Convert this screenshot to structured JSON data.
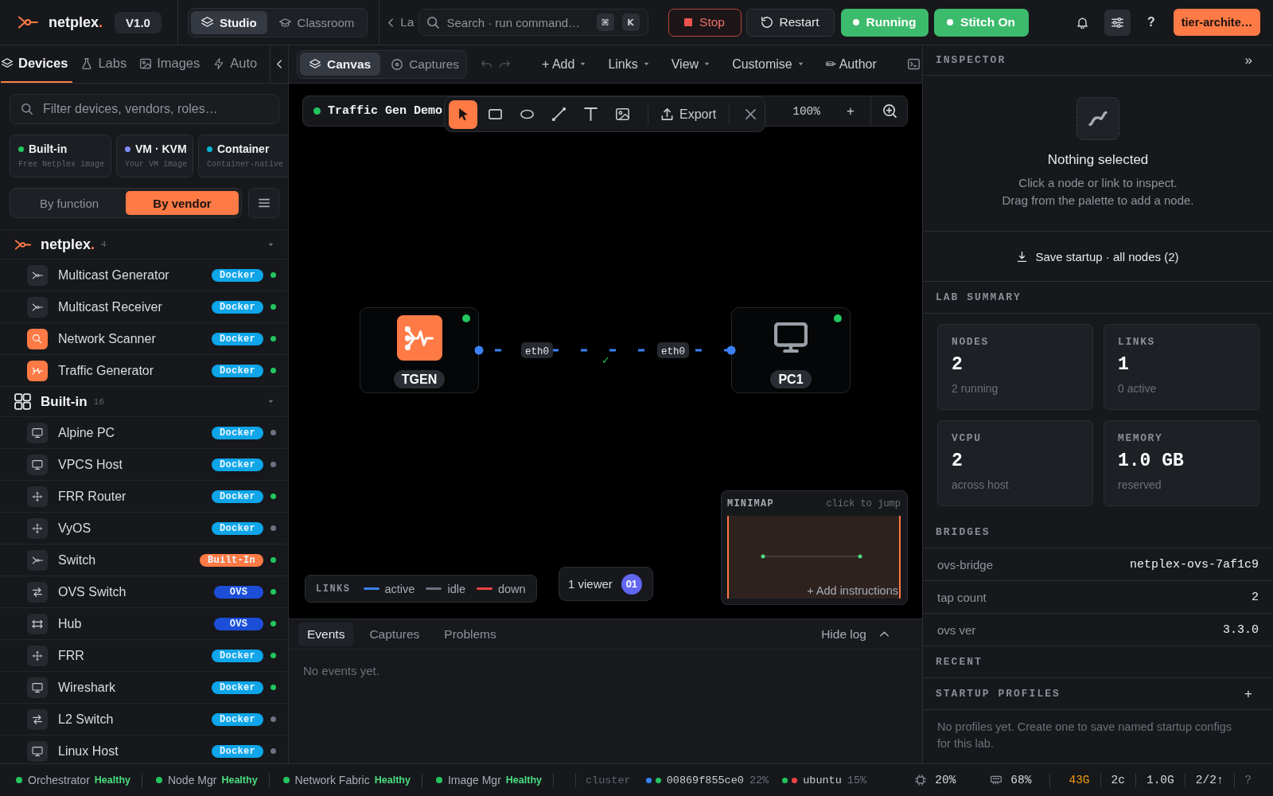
{
  "top_bar": {
    "brand": {
      "name": "netplex",
      "accent": "."
    },
    "version": "V1.0",
    "modes": [
      {
        "label": "Studio",
        "selected": true
      },
      {
        "label": "Classroom",
        "selected": false
      }
    ],
    "back_link": "La",
    "search": {
      "placeholder": "Search · run command…",
      "keys": [
        "⌘",
        "K"
      ]
    },
    "actions": [
      {
        "kind": "stop",
        "label": "Stop"
      },
      {
        "kind": "restart",
        "label": "Restart"
      },
      {
        "kind": "running",
        "label": "Running"
      },
      {
        "kind": "toggle",
        "label": "Stitch On"
      }
    ],
    "help": "?",
    "user": "tier-archite…"
  },
  "sidebar": {
    "tabs": [
      {
        "label": "Devices",
        "selected": true
      },
      {
        "label": "Labs",
        "selected": false
      },
      {
        "label": "Images",
        "selected": false
      },
      {
        "label": "Auto",
        "selected": false
      }
    ],
    "filter": {
      "placeholder": "Filter devices, vendors, roles…"
    },
    "sources": [
      {
        "title": "Built-in",
        "subtitle": "Free Netplex image",
        "color": "#22c55e"
      },
      {
        "title": "VM · KVM",
        "subtitle": "Your VM image",
        "color": "#818cf8"
      },
      {
        "title": "Container",
        "subtitle": "Container-native",
        "color": "#06b6d4"
      }
    ],
    "grouping": [
      {
        "label": "By function",
        "selected": false
      },
      {
        "label": "By vendor",
        "selected": true
      }
    ],
    "groups": [
      {
        "kind": "brand",
        "name": "netplex",
        "accent": ".",
        "count": "4",
        "expanded": true,
        "items": [
          {
            "kind": "multicast",
            "name": "Multicast Generator",
            "badge": {
              "label": "Docker",
              "color": "#0ea5e9"
            },
            "dot": {
              "color": "#22c55e"
            }
          },
          {
            "kind": "multicast",
            "name": "Multicast Receiver",
            "badge": {
              "label": "Docker",
              "color": "#0ea5e9"
            },
            "dot": {
              "color": "#22c55e"
            }
          },
          {
            "kind": "scanner",
            "name": "Network Scanner",
            "badge": {
              "label": "Docker",
              "color": "#0ea5e9"
            },
            "dot": {
              "color": "#22c55e"
            }
          },
          {
            "kind": "traffic",
            "name": "Traffic Generator",
            "badge": {
              "label": "Docker",
              "color": "#0ea5e9"
            },
            "dot": {
              "color": "#22c55e"
            }
          }
        ]
      },
      {
        "kind": "builtin",
        "name": "Built-in",
        "count": "16",
        "expanded": true,
        "items": [
          {
            "kind": "host",
            "name": "Alpine PC",
            "badge": {
              "label": "Docker",
              "color": "#0ea5e9"
            },
            "dot": {
              "color": "#6b7280"
            }
          },
          {
            "kind": "host",
            "name": "VPCS Host",
            "badge": {
              "label": "Docker",
              "color": "#0ea5e9"
            },
            "dot": {
              "color": "#6b7280"
            }
          },
          {
            "kind": "router",
            "name": "FRR Router",
            "badge": {
              "label": "Docker",
              "color": "#0ea5e9"
            },
            "dot": {
              "color": "#22c55e"
            }
          },
          {
            "kind": "router",
            "name": "VyOS",
            "badge": {
              "label": "Docker",
              "color": "#0ea5e9"
            },
            "dot": {
              "color": "#6b7280"
            }
          },
          {
            "kind": "multicast",
            "name": "Switch",
            "badge": {
              "label": "Built-In",
              "color": "#ff7a45"
            },
            "dot": {
              "color": "#22c55e"
            }
          },
          {
            "kind": "switch",
            "name": "OVS Switch",
            "badge": {
              "label": "OVS",
              "color": "#1d4ed8"
            },
            "dot": {
              "color": "#22c55e"
            }
          },
          {
            "kind": "hub",
            "name": "Hub",
            "badge": {
              "label": "OVS",
              "color": "#1d4ed8"
            },
            "dot": {
              "color": "#22c55e"
            }
          },
          {
            "kind": "router",
            "name": "FRR",
            "badge": {
              "label": "Docker",
              "color": "#0ea5e9"
            },
            "dot": {
              "color": "#22c55e"
            }
          },
          {
            "kind": "host",
            "name": "Wireshark",
            "badge": {
              "label": "Docker",
              "color": "#0ea5e9"
            },
            "dot": {
              "color": "#22c55e"
            }
          },
          {
            "kind": "switch",
            "name": "L2 Switch",
            "badge": {
              "label": "Docker",
              "color": "#0ea5e9"
            },
            "dot": {
              "color": "#6b7280"
            }
          },
          {
            "kind": "host",
            "name": "Linux Host",
            "badge": {
              "label": "Docker",
              "color": "#0ea5e9"
            },
            "dot": {
              "color": "#6b7280"
            }
          }
        ]
      }
    ]
  },
  "canvas": {
    "views": [
      {
        "label": "Canvas",
        "selected": true
      },
      {
        "label": "Captures",
        "selected": false
      }
    ],
    "history": [
      {
        "kind": "undo",
        "disabled": true
      },
      {
        "kind": "redo",
        "disabled": true
      }
    ],
    "menus": [
      {
        "label": "+ Add",
        "caret": true
      },
      {
        "label": "Links",
        "caret": true
      },
      {
        "label": "View",
        "caret": true
      },
      {
        "label": "Customise",
        "caret": true
      },
      {
        "label": "✏ Author",
        "caret": false
      }
    ],
    "lab": {
      "name": "Traffic Gen Demo",
      "dot": {
        "color": "#22c55e"
      }
    },
    "tools": [
      {
        "kind": "select",
        "selected": true
      },
      {
        "kind": "rect",
        "selected": false
      },
      {
        "kind": "ellipse",
        "selected": false
      },
      {
        "kind": "line",
        "selected": false
      },
      {
        "kind": "text",
        "selected": false
      },
      {
        "kind": "image",
        "selected": false
      }
    ],
    "export": "Export",
    "zoom": "100%",
    "zoom_step": "+",
    "nodes": [
      {
        "kind": "traffic",
        "label": "TGEN",
        "running": true
      },
      {
        "kind": "host",
        "label": "PC1",
        "running": true
      }
    ],
    "links": [
      {
        "active": true,
        "ports": [
          "eth0",
          "eth0"
        ],
        "mark": "✓"
      }
    ],
    "legend": {
      "title": "LINKS",
      "items": [
        {
          "label": "active",
          "color": "#3b82f6"
        },
        {
          "label": "idle",
          "color": "#6b7280"
        },
        {
          "label": "down",
          "color": "#ef4444"
        }
      ]
    },
    "viewers": {
      "label": "1 viewer",
      "avatar": "01"
    },
    "minimap": {
      "title": "MINIMAP",
      "hint": "click to jump",
      "action": "+ Add instructions"
    }
  },
  "log": {
    "tabs": [
      {
        "label": "Events",
        "selected": true
      },
      {
        "label": "Captures",
        "selected": false
      },
      {
        "label": "Problems",
        "selected": false
      }
    ],
    "toggle": "Hide log",
    "empty": "No events yet."
  },
  "inspector": {
    "title": "INSPECTOR",
    "collapse": "»",
    "empty_title": "Nothing selected",
    "empty_hint": [
      "Click a node or link to inspect.",
      "Drag from the palette to add a node."
    ],
    "save": "Save startup · all nodes (2)"
  },
  "lab_summary": {
    "title": "LAB SUMMARY",
    "stats": [
      {
        "label": "NODES",
        "value": "2",
        "note": "2 running"
      },
      {
        "label": "LINKS",
        "value": "1",
        "note": "0 active"
      },
      {
        "label": "VCPU",
        "value": "2",
        "note": "across host"
      },
      {
        "label": "MEMORY",
        "value": "1.0 GB",
        "note": "reserved"
      }
    ]
  },
  "bridges": {
    "title": "BRIDGES",
    "rows": [
      {
        "key": "ovs-bridge",
        "value": "netplex-ovs-7af1c9"
      },
      {
        "key": "tap count",
        "value": "2"
      },
      {
        "key": "ovs ver",
        "value": "3.3.0"
      }
    ]
  },
  "recent": {
    "title": "RECENT"
  },
  "startup_profiles": {
    "title": "STARTUP PROFILES",
    "add": "+",
    "empty": "No profiles yet. Create one to save named startup configs for this lab."
  },
  "status_bar": {
    "services": [
      {
        "name": "Orchestrator",
        "status": "Healthy",
        "color": "#22c55e"
      },
      {
        "name": "Node Mgr",
        "status": "Healthy",
        "color": "#22c55e"
      },
      {
        "name": "Network Fabric",
        "status": "Healthy",
        "color": "#22c55e"
      },
      {
        "name": "Image Mgr",
        "status": "Healthy",
        "color": "#22c55e"
      }
    ],
    "cluster": {
      "label": "cluster",
      "hosts": [
        {
          "dots": [
            {
              "color": "#3b82f6"
            },
            {
              "color": "#22c55e"
            }
          ],
          "name": "00869f855ce0",
          "load": "22%"
        },
        {
          "dots": [
            {
              "color": "#22c55e"
            },
            {
              "color": "#ef4444"
            }
          ],
          "name": "ubuntu",
          "load": "15%"
        }
      ]
    },
    "metrics": [
      {
        "kind": "cpu",
        "value": "20%",
        "warning": false
      },
      {
        "kind": "memory",
        "value": "68%",
        "warning": false
      },
      {
        "kind": "plain",
        "value": "43G",
        "warning": true
      },
      {
        "kind": "plain",
        "value": "2c",
        "warning": false
      },
      {
        "kind": "plain",
        "value": "1.0G",
        "warning": false
      },
      {
        "kind": "plain",
        "value": "2/2↑",
        "warning": false
      }
    ],
    "help": "?"
  }
}
